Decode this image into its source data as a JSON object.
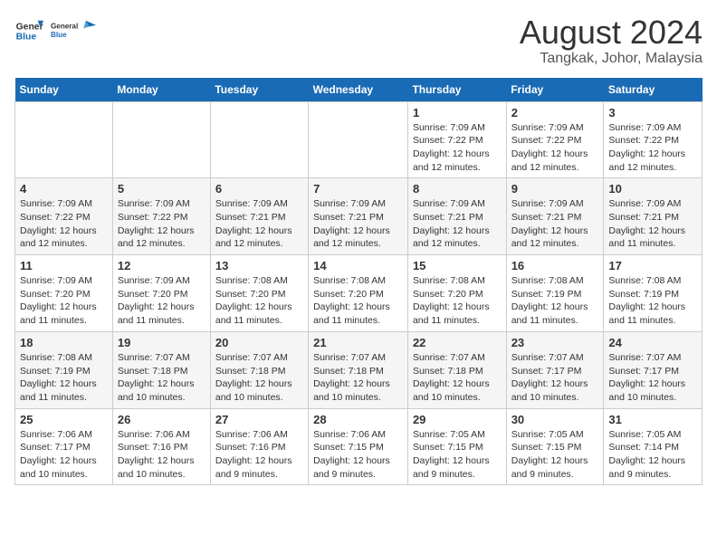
{
  "logo": {
    "line1": "General",
    "line2": "Blue"
  },
  "title": "August 2024",
  "location": "Tangkak, Johor, Malaysia",
  "days_of_week": [
    "Sunday",
    "Monday",
    "Tuesday",
    "Wednesday",
    "Thursday",
    "Friday",
    "Saturday"
  ],
  "weeks": [
    [
      {
        "num": "",
        "info": ""
      },
      {
        "num": "",
        "info": ""
      },
      {
        "num": "",
        "info": ""
      },
      {
        "num": "",
        "info": ""
      },
      {
        "num": "1",
        "info": "Sunrise: 7:09 AM\nSunset: 7:22 PM\nDaylight: 12 hours\nand 12 minutes."
      },
      {
        "num": "2",
        "info": "Sunrise: 7:09 AM\nSunset: 7:22 PM\nDaylight: 12 hours\nand 12 minutes."
      },
      {
        "num": "3",
        "info": "Sunrise: 7:09 AM\nSunset: 7:22 PM\nDaylight: 12 hours\nand 12 minutes."
      }
    ],
    [
      {
        "num": "4",
        "info": "Sunrise: 7:09 AM\nSunset: 7:22 PM\nDaylight: 12 hours\nand 12 minutes."
      },
      {
        "num": "5",
        "info": "Sunrise: 7:09 AM\nSunset: 7:22 PM\nDaylight: 12 hours\nand 12 minutes."
      },
      {
        "num": "6",
        "info": "Sunrise: 7:09 AM\nSunset: 7:21 PM\nDaylight: 12 hours\nand 12 minutes."
      },
      {
        "num": "7",
        "info": "Sunrise: 7:09 AM\nSunset: 7:21 PM\nDaylight: 12 hours\nand 12 minutes."
      },
      {
        "num": "8",
        "info": "Sunrise: 7:09 AM\nSunset: 7:21 PM\nDaylight: 12 hours\nand 12 minutes."
      },
      {
        "num": "9",
        "info": "Sunrise: 7:09 AM\nSunset: 7:21 PM\nDaylight: 12 hours\nand 12 minutes."
      },
      {
        "num": "10",
        "info": "Sunrise: 7:09 AM\nSunset: 7:21 PM\nDaylight: 12 hours\nand 11 minutes."
      }
    ],
    [
      {
        "num": "11",
        "info": "Sunrise: 7:09 AM\nSunset: 7:20 PM\nDaylight: 12 hours\nand 11 minutes."
      },
      {
        "num": "12",
        "info": "Sunrise: 7:09 AM\nSunset: 7:20 PM\nDaylight: 12 hours\nand 11 minutes."
      },
      {
        "num": "13",
        "info": "Sunrise: 7:08 AM\nSunset: 7:20 PM\nDaylight: 12 hours\nand 11 minutes."
      },
      {
        "num": "14",
        "info": "Sunrise: 7:08 AM\nSunset: 7:20 PM\nDaylight: 12 hours\nand 11 minutes."
      },
      {
        "num": "15",
        "info": "Sunrise: 7:08 AM\nSunset: 7:20 PM\nDaylight: 12 hours\nand 11 minutes."
      },
      {
        "num": "16",
        "info": "Sunrise: 7:08 AM\nSunset: 7:19 PM\nDaylight: 12 hours\nand 11 minutes."
      },
      {
        "num": "17",
        "info": "Sunrise: 7:08 AM\nSunset: 7:19 PM\nDaylight: 12 hours\nand 11 minutes."
      }
    ],
    [
      {
        "num": "18",
        "info": "Sunrise: 7:08 AM\nSunset: 7:19 PM\nDaylight: 12 hours\nand 11 minutes."
      },
      {
        "num": "19",
        "info": "Sunrise: 7:07 AM\nSunset: 7:18 PM\nDaylight: 12 hours\nand 10 minutes."
      },
      {
        "num": "20",
        "info": "Sunrise: 7:07 AM\nSunset: 7:18 PM\nDaylight: 12 hours\nand 10 minutes."
      },
      {
        "num": "21",
        "info": "Sunrise: 7:07 AM\nSunset: 7:18 PM\nDaylight: 12 hours\nand 10 minutes."
      },
      {
        "num": "22",
        "info": "Sunrise: 7:07 AM\nSunset: 7:18 PM\nDaylight: 12 hours\nand 10 minutes."
      },
      {
        "num": "23",
        "info": "Sunrise: 7:07 AM\nSunset: 7:17 PM\nDaylight: 12 hours\nand 10 minutes."
      },
      {
        "num": "24",
        "info": "Sunrise: 7:07 AM\nSunset: 7:17 PM\nDaylight: 12 hours\nand 10 minutes."
      }
    ],
    [
      {
        "num": "25",
        "info": "Sunrise: 7:06 AM\nSunset: 7:17 PM\nDaylight: 12 hours\nand 10 minutes."
      },
      {
        "num": "26",
        "info": "Sunrise: 7:06 AM\nSunset: 7:16 PM\nDaylight: 12 hours\nand 10 minutes."
      },
      {
        "num": "27",
        "info": "Sunrise: 7:06 AM\nSunset: 7:16 PM\nDaylight: 12 hours\nand 9 minutes."
      },
      {
        "num": "28",
        "info": "Sunrise: 7:06 AM\nSunset: 7:15 PM\nDaylight: 12 hours\nand 9 minutes."
      },
      {
        "num": "29",
        "info": "Sunrise: 7:05 AM\nSunset: 7:15 PM\nDaylight: 12 hours\nand 9 minutes."
      },
      {
        "num": "30",
        "info": "Sunrise: 7:05 AM\nSunset: 7:15 PM\nDaylight: 12 hours\nand 9 minutes."
      },
      {
        "num": "31",
        "info": "Sunrise: 7:05 AM\nSunset: 7:14 PM\nDaylight: 12 hours\nand 9 minutes."
      }
    ]
  ]
}
